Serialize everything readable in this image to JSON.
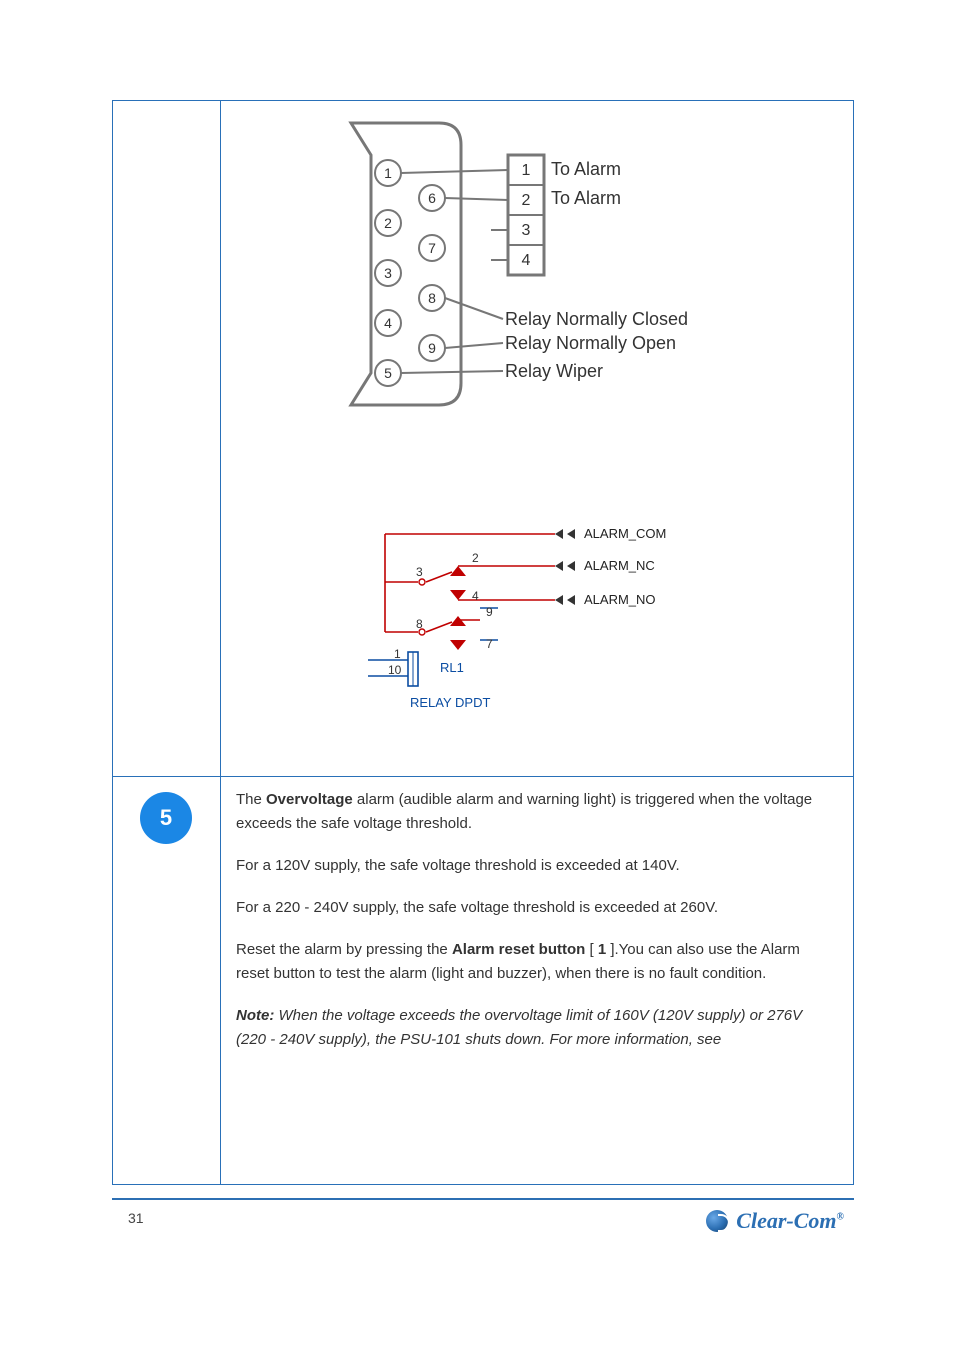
{
  "callout": {
    "number": "5"
  },
  "diagram1": {
    "shell_pins": [
      "1",
      "2",
      "3",
      "4",
      "5",
      "6",
      "7",
      "8",
      "9"
    ],
    "block_pins": [
      "1",
      "2",
      "3",
      "4"
    ],
    "block_labels": {
      "l1": "To Alarm",
      "l2": "To Alarm"
    },
    "line_labels": {
      "nc": "Relay Normally Closed",
      "no": "Relay Normally Open",
      "wiper": "Relay Wiper"
    }
  },
  "diagram2": {
    "nets": {
      "com": "ALARM_COM",
      "nc": "ALARM_NC",
      "no": "ALARM_NO"
    },
    "node_numbers": [
      "2",
      "3",
      "4",
      "9",
      "8",
      "7",
      "1",
      "10"
    ],
    "refdes": "RL1",
    "part": "RELAY DPDT"
  },
  "body": {
    "p1_prefix": "The ",
    "p1_bold": "Overvoltage ",
    "p1_rest": "alarm (audible alarm and warning light) is triggered when the voltage exceeds the safe voltage threshold.",
    "p2": "For a 120V supply, the safe voltage threshold is exceeded at 140V.",
    "p3": "For a 220 - 240V supply, the safe voltage threshold is exceeded at 260V.",
    "p4_prefix": "Reset the alarm by pressing the ",
    "p4_bold": "Alarm reset button ",
    "p4_mid": "[ ",
    "p4_bold2": "1 ",
    "p4_rest": "].You can also use the Alarm reset button to test the alarm (light and buzzer), when there is no fault condition.",
    "note_label": "Note:",
    "note_text": "When the voltage exceeds the overvoltage limit of 160V (120V supply) or 276V (220 - 240V supply), the PSU-101 shuts down. For more information, see"
  },
  "footer": {
    "page": "31",
    "brand": "Clear-Com",
    "reg": "®"
  }
}
